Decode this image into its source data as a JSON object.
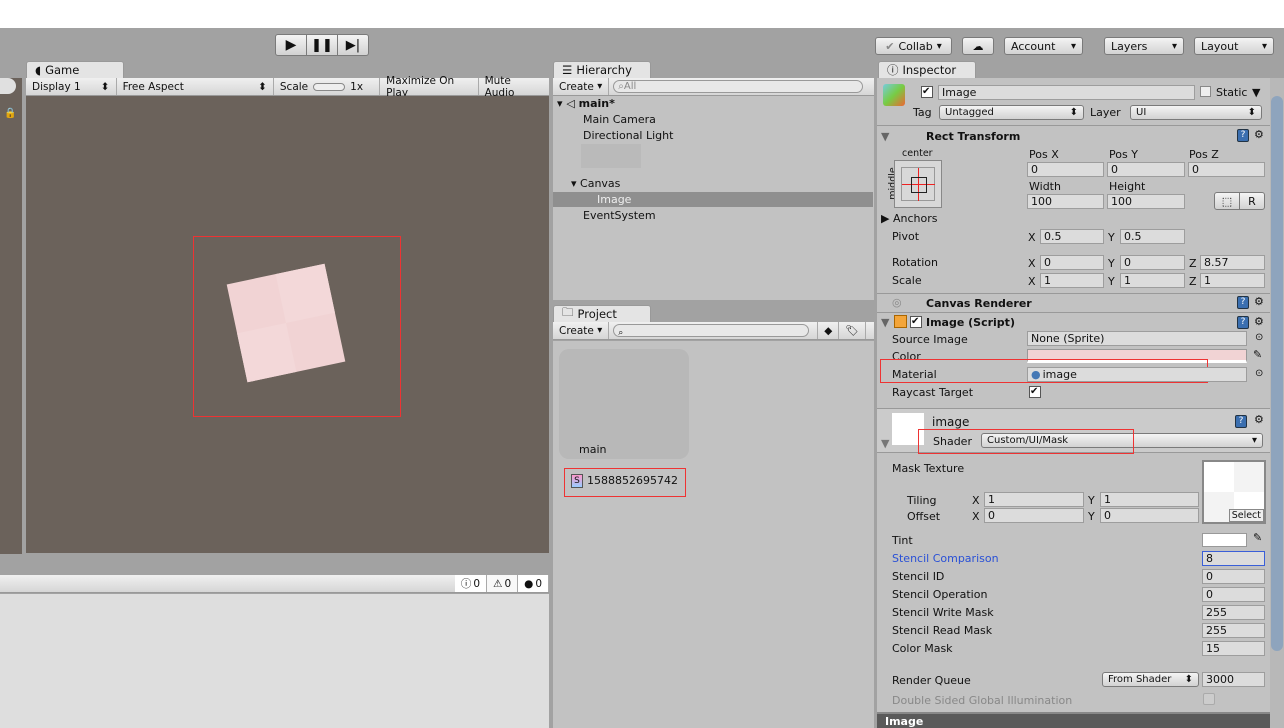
{
  "toolbar": {
    "play_icon": "play-icon",
    "pause_icon": "pause-icon",
    "step_icon": "step-icon",
    "collab": "Collab",
    "account": "Account",
    "layers": "Layers",
    "layout": "Layout"
  },
  "game": {
    "tab": "Game",
    "display": "Display 1",
    "aspect": "Free Aspect",
    "scale_label": "Scale",
    "scale_value": "1x",
    "maximize": "Maximize On Play",
    "mute": "Mute Audio",
    "image_color": "#f1d3d4"
  },
  "console": {
    "info_count": "0",
    "warn_count": "0",
    "error_count": "0"
  },
  "hierarchy": {
    "tab": "Hierarchy",
    "create": "Create",
    "search_placeholder": "All",
    "scene": "main*",
    "items": [
      "Main Camera",
      "Directional Light",
      "Canvas",
      "Image",
      "EventSystem"
    ]
  },
  "project": {
    "tab": "Project",
    "create": "Create",
    "items": [
      "main",
      "1588852695742"
    ]
  },
  "inspector": {
    "tab": "Inspector",
    "name": "Image",
    "static": "Static",
    "tag_label": "Tag",
    "tag": "Untagged",
    "layer_label": "Layer",
    "layer": "UI",
    "rect": {
      "title": "Rect Transform",
      "anchor_h": "center",
      "anchor_v": "middle",
      "posx_l": "Pos X",
      "posy_l": "Pos Y",
      "posz_l": "Pos Z",
      "posx": "0",
      "posy": "0",
      "posz": "0",
      "width_l": "Width",
      "height_l": "Height",
      "width": "100",
      "height": "100",
      "r": "R",
      "anchors": "Anchors",
      "pivot": "Pivot",
      "pivot_x": "0.5",
      "pivot_y": "0.5",
      "rotation": "Rotation",
      "rot_x": "0",
      "rot_y": "0",
      "rot_z": "8.57",
      "scale": "Scale",
      "sc_x": "1",
      "sc_y": "1",
      "sc_z": "1",
      "x": "X",
      "y": "Y",
      "z": "Z"
    },
    "canvas_renderer": "Canvas Renderer",
    "image": {
      "title": "Image (Script)",
      "source_l": "Source Image",
      "source": "None (Sprite)",
      "color_l": "Color",
      "material_l": "Material",
      "material": "image",
      "raycast_l": "Raycast Target"
    },
    "material": {
      "name": "image",
      "shader_l": "Shader",
      "shader": "Custom/UI/Mask",
      "mask_tex": "Mask Texture",
      "tiling": "Tiling",
      "offset": "Offset",
      "tx": "1",
      "ty": "1",
      "ox": "0",
      "oy": "0",
      "select": "Select",
      "tint": "Tint",
      "props": [
        {
          "label": "Stencil Comparison",
          "value": "8"
        },
        {
          "label": "Stencil ID",
          "value": "0"
        },
        {
          "label": "Stencil Operation",
          "value": "0"
        },
        {
          "label": "Stencil Write Mask",
          "value": "255"
        },
        {
          "label": "Stencil Read Mask",
          "value": "255"
        },
        {
          "label": "Color Mask",
          "value": "15"
        }
      ],
      "rq_l": "Render Queue",
      "rq_mode": "From Shader",
      "rq": "3000",
      "dsgi": "Double Sided Global Illumination"
    },
    "footer": "Image"
  }
}
